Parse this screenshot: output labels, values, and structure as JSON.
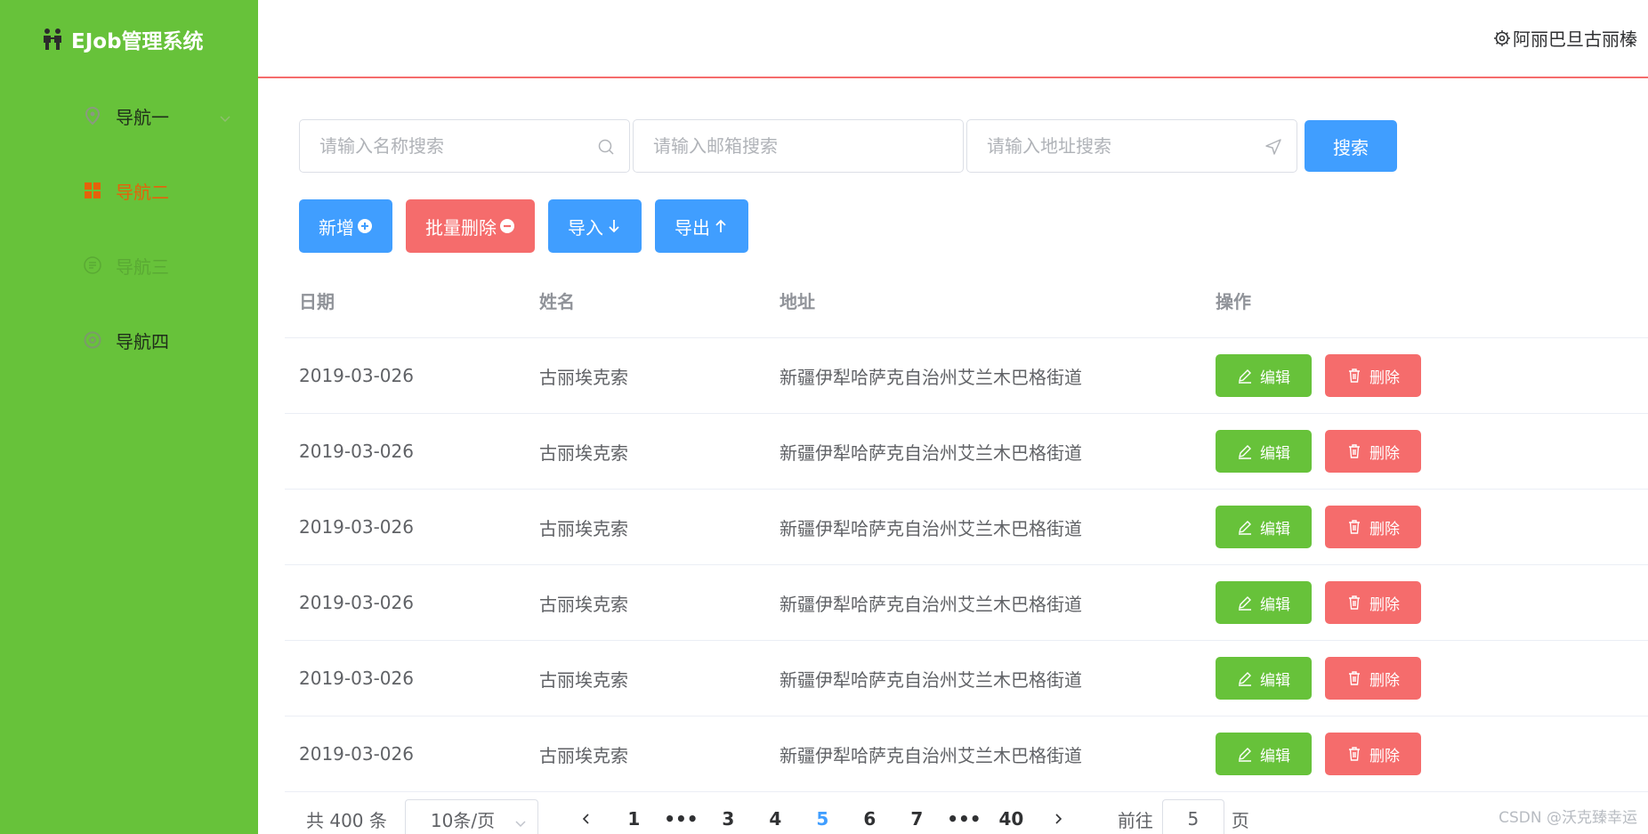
{
  "brand": {
    "title": "EJob管理系统"
  },
  "sidebar": {
    "items": [
      {
        "label": "导航一"
      },
      {
        "label": "导航二"
      },
      {
        "label": "导航三"
      },
      {
        "label": "导航四"
      }
    ]
  },
  "header": {
    "user": "阿丽巴旦古丽榛"
  },
  "search": {
    "name_placeholder": "请输入名称搜索",
    "email_placeholder": "请输入邮箱搜索",
    "address_placeholder": "请输入地址搜索",
    "button": "搜索"
  },
  "actions": {
    "add": "新增",
    "batch_delete": "批量删除",
    "import": "导入",
    "export": "导出"
  },
  "table": {
    "headers": [
      "日期",
      "姓名",
      "地址",
      "操作"
    ],
    "edit_label": "编辑",
    "delete_label": "删除",
    "rows": [
      {
        "date": "2019-03-026",
        "name": "古丽埃克索",
        "address": "新疆伊犁哈萨克自治州艾兰木巴格街道"
      },
      {
        "date": "2019-03-026",
        "name": "古丽埃克索",
        "address": "新疆伊犁哈萨克自治州艾兰木巴格街道"
      },
      {
        "date": "2019-03-026",
        "name": "古丽埃克索",
        "address": "新疆伊犁哈萨克自治州艾兰木巴格街道"
      },
      {
        "date": "2019-03-026",
        "name": "古丽埃克索",
        "address": "新疆伊犁哈萨克自治州艾兰木巴格街道"
      },
      {
        "date": "2019-03-026",
        "name": "古丽埃克索",
        "address": "新疆伊犁哈萨克自治州艾兰木巴格街道"
      },
      {
        "date": "2019-03-026",
        "name": "古丽埃克索",
        "address": "新疆伊犁哈萨克自治州艾兰木巴格街道"
      }
    ]
  },
  "pagination": {
    "total": "共 400 条",
    "page_size": "10条/页",
    "pages": [
      "1",
      "•••",
      "3",
      "4",
      "5",
      "6",
      "7",
      "•••",
      "40"
    ],
    "current": "5",
    "goto_prefix": "前往",
    "goto_value": "5",
    "goto_suffix": "页"
  },
  "watermark": "CSDN @沃克臻幸运",
  "colors": {
    "sidebar": "#67c23a",
    "primary": "#409eff",
    "danger": "#f56c6c",
    "success": "#67c23a",
    "active_nav": "#e6620a"
  }
}
